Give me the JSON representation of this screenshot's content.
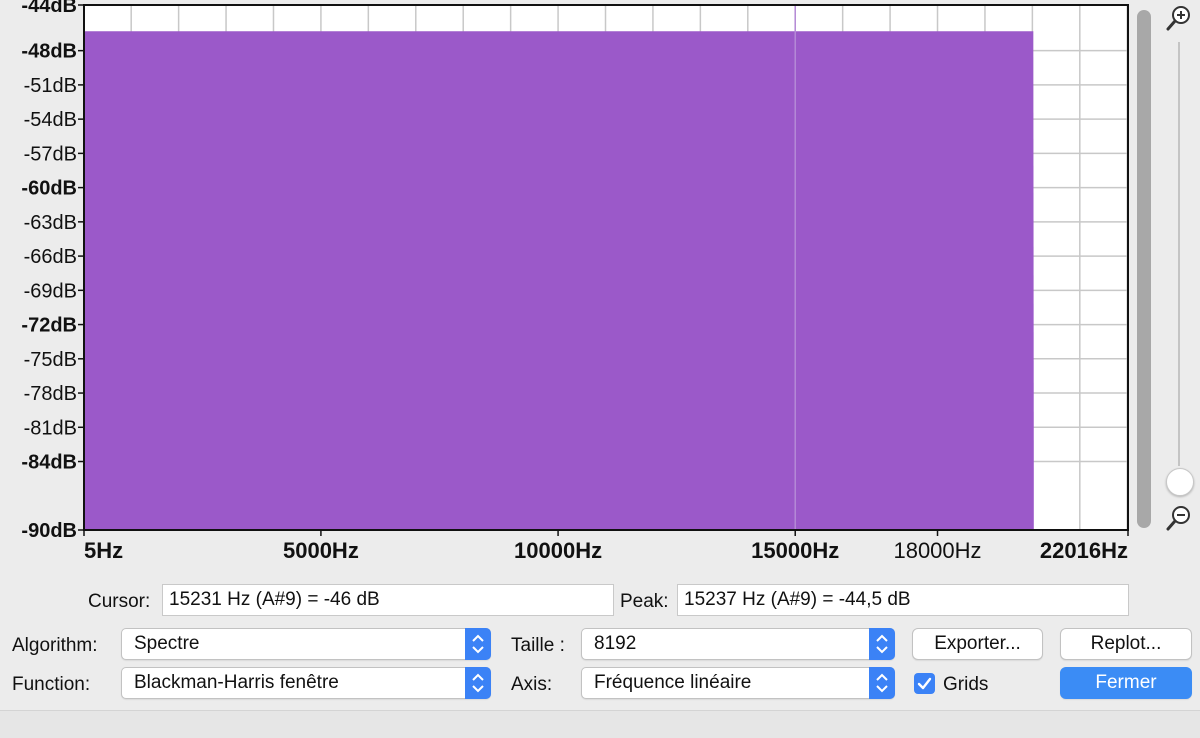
{
  "chart_data": {
    "type": "area",
    "title": "",
    "xlabel": "",
    "ylabel": "",
    "x_ticks": [
      {
        "label": "5Hz",
        "value": 5,
        "bold": true
      },
      {
        "label": "5000Hz",
        "value": 5000,
        "bold": true
      },
      {
        "label": "10000Hz",
        "value": 10000,
        "bold": true
      },
      {
        "label": "15000Hz",
        "value": 15000,
        "bold": true
      },
      {
        "label": "18000Hz",
        "value": 18000,
        "bold": false
      },
      {
        "label": "22016Hz",
        "value": 22016,
        "bold": true
      }
    ],
    "xlim": [
      5,
      22016
    ],
    "y_ticks": [
      {
        "label": "-44dB",
        "value": -44,
        "bold": true
      },
      {
        "label": "-48dB",
        "value": -48,
        "bold": true
      },
      {
        "label": "-51dB",
        "value": -51,
        "bold": false
      },
      {
        "label": "-54dB",
        "value": -54,
        "bold": false
      },
      {
        "label": "-57dB",
        "value": -57,
        "bold": false
      },
      {
        "label": "-60dB",
        "value": -60,
        "bold": true
      },
      {
        "label": "-63dB",
        "value": -63,
        "bold": false
      },
      {
        "label": "-66dB",
        "value": -66,
        "bold": false
      },
      {
        "label": "-69dB",
        "value": -69,
        "bold": false
      },
      {
        "label": "-72dB",
        "value": -72,
        "bold": true
      },
      {
        "label": "-75dB",
        "value": -75,
        "bold": false
      },
      {
        "label": "-78dB",
        "value": -78,
        "bold": false
      },
      {
        "label": "-81dB",
        "value": -81,
        "bold": false
      },
      {
        "label": "-84dB",
        "value": -84,
        "bold": true
      },
      {
        "label": "-90dB",
        "value": -90,
        "bold": true
      }
    ],
    "ylim": [
      -90,
      -44
    ],
    "grid": true,
    "series": [
      {
        "color": "#9b59c9",
        "x": [
          5,
          2000,
          4000,
          6000,
          8000,
          10000,
          12000,
          14000,
          16000,
          18000,
          20000,
          20020,
          20030
        ],
        "y": [
          -46.3,
          -46.3,
          -46.3,
          -46.3,
          -46.3,
          -46.3,
          -46.3,
          -46.3,
          -46.3,
          -46.3,
          -46.3,
          -46.3,
          -84.5
        ]
      }
    ]
  },
  "readout": {
    "cursor_label": "Cursor:",
    "cursor_value": "15231 Hz (A#9) = -46 dB",
    "peak_label": "Peak:",
    "peak_value": "15237 Hz (A#9) = -44,5 dB"
  },
  "controls": {
    "algorithm_label": "Algorithm:",
    "algorithm_value": "Spectre",
    "size_label": "Taille :",
    "size_value": "8192",
    "function_label": "Function:",
    "function_value": "Blackman-Harris fenêtre",
    "axis_label": "Axis:",
    "axis_value": "Fréquence linéaire",
    "grids_label": "Grids",
    "grids_checked": true
  },
  "buttons": {
    "export": "Exporter...",
    "replot": "Replot...",
    "close": "Fermer"
  },
  "colors": {
    "accent": "#3b82f6",
    "spectrum": "#9b59c9"
  }
}
